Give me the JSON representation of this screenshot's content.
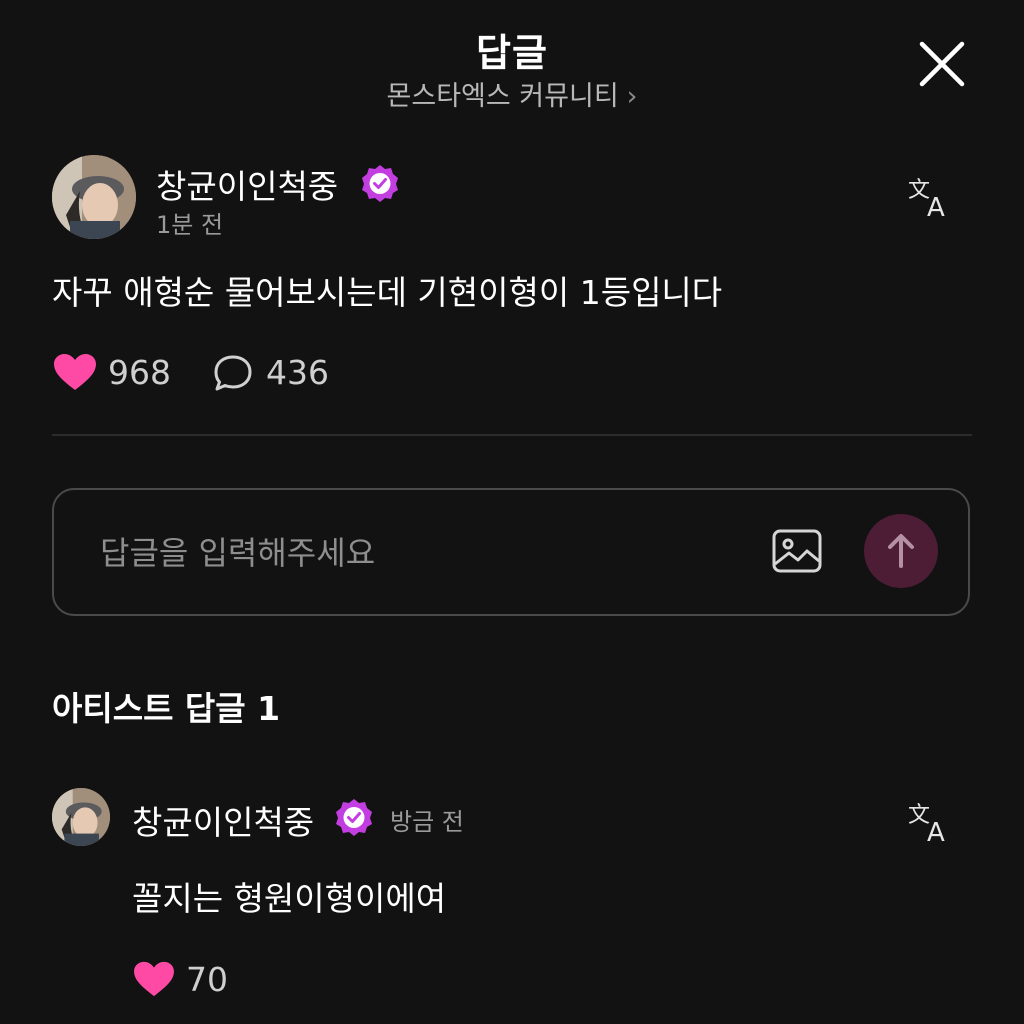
{
  "header": {
    "title": "답글",
    "community": "몬스타엑스 커뮤니티",
    "community_chevron": "›"
  },
  "post": {
    "username": "창균이인척중",
    "verified_color": "#c23ee0",
    "time": "1분 전",
    "text": "자꾸 애형순 물어보시는데 기현이형이 1등입니다",
    "likes": "968",
    "comments": "436"
  },
  "reply_input": {
    "placeholder": "답글을 입력해주세요"
  },
  "artist_replies": {
    "title": "아티스트 답글 1",
    "items": [
      {
        "username": "창균이인척중",
        "time": "방금 전",
        "text": "꼴지는 형원이형이에여",
        "likes": "70"
      }
    ]
  },
  "colors": {
    "background": "#121212",
    "heart": "#ff4aa5",
    "send_button": "#4d1c35",
    "badge": "#c23ee0"
  },
  "icons": [
    "close-icon",
    "chevron-right-icon",
    "verified-badge-icon",
    "translate-icon",
    "heart-icon",
    "comment-icon",
    "image-icon",
    "arrow-up-icon"
  ]
}
